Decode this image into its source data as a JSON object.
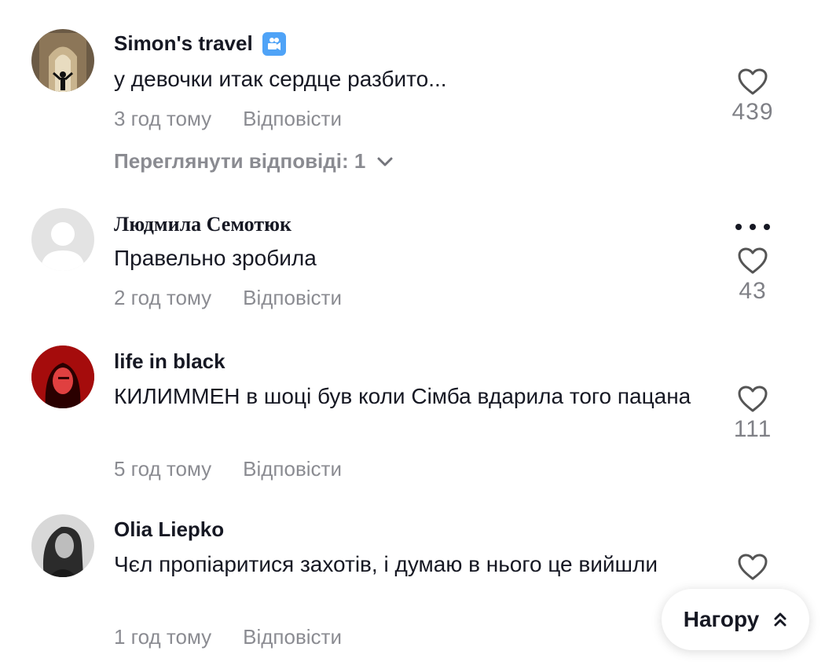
{
  "comments": [
    {
      "username": "Simon's travel",
      "text": "у девочки итак сердце разбито...",
      "time": "3 год тому",
      "reply_label": "Відповісти",
      "likes": "439",
      "replies_label": "Переглянути відповіді: 1"
    },
    {
      "username": "Людмила Семотюк",
      "text": "Правельно зробила",
      "time": "2 год тому",
      "reply_label": "Відповісти",
      "likes": "43"
    },
    {
      "username": "life in black",
      "text": "КИЛИММЕН в шоці був коли Сімба вдарила того пацана",
      "time": "5 год тому",
      "reply_label": "Відповісти",
      "likes": "111"
    },
    {
      "username": "Olia Liepko",
      "text": "Чєл пропіаритися захотів, і думаю в нього це вийшли",
      "time": "1 год тому",
      "reply_label": "Відповісти",
      "likes": ""
    }
  ],
  "to_top_label": "Нагору",
  "colors": {
    "text_primary": "#161823",
    "text_secondary": "rgba(22,24,35,0.5)",
    "badge_blue": "#4fa3f7"
  }
}
